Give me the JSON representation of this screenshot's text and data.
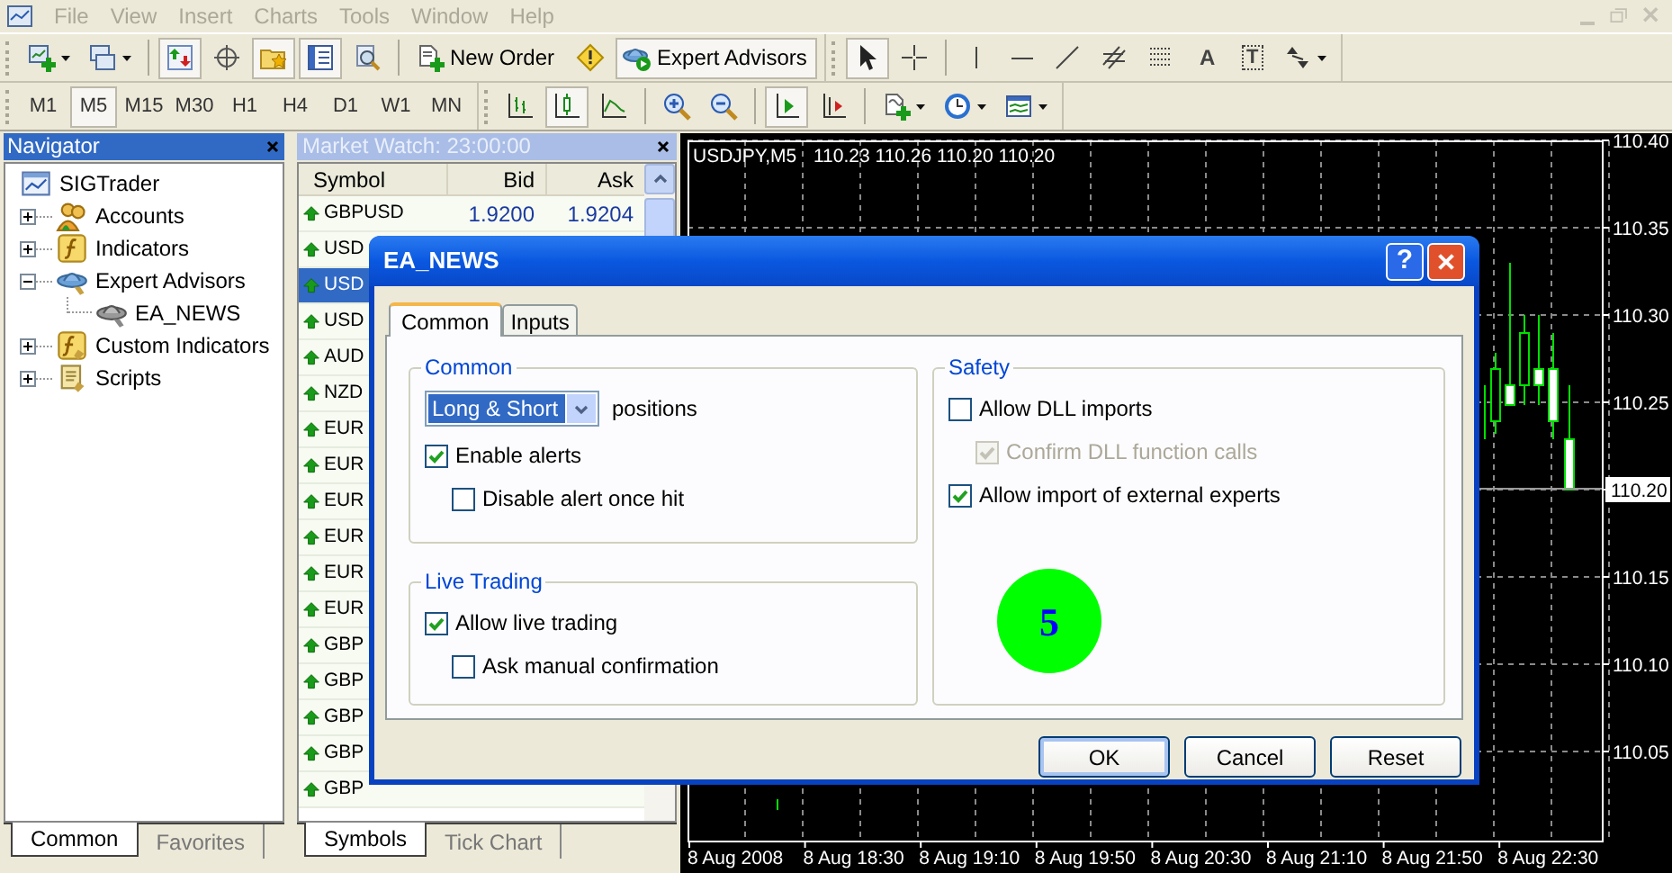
{
  "menu": [
    "File",
    "View",
    "Insert",
    "Charts",
    "Tools",
    "Window",
    "Help"
  ],
  "toolbars": [
    {
      "segments": [
        {
          "items": [
            {
              "kind": "new-chart",
              "on": false,
              "dropdown": true
            },
            {
              "kind": "profiles",
              "on": false,
              "dropdown": true
            },
            {
              "kind": "separator"
            },
            {
              "kind": "market-watch",
              "on": true
            },
            {
              "kind": "data-window",
              "on": false
            },
            {
              "kind": "navigator",
              "on": true
            },
            {
              "kind": "terminal",
              "on": true
            },
            {
              "kind": "tester",
              "on": false
            },
            {
              "kind": "separator"
            },
            {
              "kind": "new-order",
              "label": "New Order",
              "on": false
            },
            {
              "kind": "metaeditor",
              "on": false
            },
            {
              "kind": "expert-advisors",
              "label": "Expert Advisors",
              "on": true
            }
          ]
        },
        {
          "items": [
            {
              "kind": "cursor",
              "on": true
            },
            {
              "kind": "crosshair",
              "on": false
            },
            {
              "kind": "separator"
            },
            {
              "kind": "vline",
              "on": false
            },
            {
              "kind": "hline",
              "on": false
            },
            {
              "kind": "trendline",
              "on": false
            },
            {
              "kind": "fibo-e",
              "on": false
            },
            {
              "kind": "fibo-f",
              "on": false
            },
            {
              "kind": "text",
              "label": "A",
              "on": false
            },
            {
              "kind": "label",
              "label": "T",
              "on": false
            },
            {
              "kind": "arrows",
              "on": false,
              "dropdown": true
            }
          ]
        }
      ]
    },
    {
      "segments": [
        {
          "items": [
            {
              "kind": "period",
              "label": "M1",
              "on": false
            },
            {
              "kind": "period",
              "label": "M5",
              "on": true
            },
            {
              "kind": "period",
              "label": "M15",
              "on": false
            },
            {
              "kind": "period",
              "label": "M30",
              "on": false
            },
            {
              "kind": "period",
              "label": "H1",
              "on": false
            },
            {
              "kind": "period",
              "label": "H4",
              "on": false
            },
            {
              "kind": "period",
              "label": "D1",
              "on": false
            },
            {
              "kind": "period",
              "label": "W1",
              "on": false
            },
            {
              "kind": "period",
              "label": "MN",
              "on": false
            }
          ]
        },
        {
          "items": [
            {
              "kind": "bar-chart",
              "on": false
            },
            {
              "kind": "candles",
              "on": true
            },
            {
              "kind": "line-chart",
              "on": false
            },
            {
              "kind": "separator"
            },
            {
              "kind": "zoom-in",
              "on": false
            },
            {
              "kind": "zoom-out",
              "on": false
            },
            {
              "kind": "separator"
            },
            {
              "kind": "autoscroll",
              "on": true
            },
            {
              "kind": "chart-shift",
              "on": false
            },
            {
              "kind": "separator"
            },
            {
              "kind": "indicators",
              "on": false,
              "dropdown": true
            },
            {
              "kind": "periods",
              "on": false,
              "dropdown": true
            },
            {
              "kind": "templates",
              "on": false,
              "dropdown": true
            }
          ]
        }
      ]
    }
  ],
  "navigator": {
    "title": "Navigator",
    "tree": {
      "label": "SIGTrader",
      "kind": "terminal",
      "children": [
        {
          "label": "Accounts",
          "kind": "accounts",
          "expanded": false
        },
        {
          "label": "Indicators",
          "kind": "indicators",
          "expanded": false
        },
        {
          "label": "Expert Advisors",
          "kind": "experts",
          "expanded": true,
          "children": [
            {
              "label": "EA_NEWS",
              "kind": "expert"
            }
          ]
        },
        {
          "label": "Custom Indicators",
          "kind": "custom",
          "expanded": false
        },
        {
          "label": "Scripts",
          "kind": "scripts",
          "expanded": false
        }
      ]
    },
    "tabs": [
      {
        "label": "Common",
        "selected": true
      },
      {
        "label": "Favorites",
        "selected": false
      }
    ]
  },
  "market_watch": {
    "title": "Market Watch: 23:00:00",
    "columns": [
      "Symbol",
      "Bid",
      "Ask"
    ],
    "rows": [
      {
        "symbol": "GBPUSD",
        "bid": "1.9200",
        "ask": "1.9204",
        "selected": false
      },
      {
        "symbol": "USD",
        "selected": false
      },
      {
        "symbol": "USD",
        "selected": true
      },
      {
        "symbol": "USD",
        "selected": false
      },
      {
        "symbol": "AUD",
        "selected": false
      },
      {
        "symbol": "NZD",
        "selected": false
      },
      {
        "symbol": "EUR",
        "selected": false
      },
      {
        "symbol": "EUR",
        "selected": false
      },
      {
        "symbol": "EUR",
        "selected": false
      },
      {
        "symbol": "EUR",
        "selected": false
      },
      {
        "symbol": "EUR",
        "selected": false
      },
      {
        "symbol": "EUR",
        "selected": false
      },
      {
        "symbol": "GBP",
        "selected": false
      },
      {
        "symbol": "GBP",
        "selected": false
      },
      {
        "symbol": "GBP",
        "selected": false
      },
      {
        "symbol": "GBP",
        "selected": false
      },
      {
        "symbol": "GBP",
        "selected": false
      }
    ],
    "tabs": [
      {
        "label": "Symbols",
        "selected": true
      },
      {
        "label": "Tick Chart",
        "selected": false
      }
    ]
  },
  "chart": {
    "symbol": "USDJPY,M5",
    "ohlc": "110.23 110.26 110.20 110.20",
    "price_labels": [
      {
        "label": "110.40",
        "current": false
      },
      {
        "label": "110.35",
        "current": false
      },
      {
        "label": "110.30",
        "current": false
      },
      {
        "label": "110.25",
        "current": false
      },
      {
        "label": "110.20",
        "current": true
      },
      {
        "label": "110.15",
        "current": false
      },
      {
        "label": "110.10",
        "current": false
      },
      {
        "label": "110.05",
        "current": false
      }
    ],
    "time_labels": [
      "8 Aug 2008",
      "8 Aug 18:30",
      "8 Aug 19:10",
      "8 Aug 19:50",
      "8 Aug 20:30",
      "8 Aug 21:10",
      "8 Aug 21:50",
      "8 Aug 22:30"
    ]
  },
  "dialog": {
    "title": "EA_NEWS",
    "help": "?",
    "tabs": [
      {
        "label": "Common",
        "selected": true
      },
      {
        "label": "Inputs",
        "selected": false
      }
    ],
    "groups": [
      {
        "title": "Common",
        "select": {
          "value": "Long & Short",
          "label": "positions"
        },
        "options": [
          {
            "label": "Enable alerts",
            "checked": true,
            "disabled": false,
            "children": [
              {
                "label": "Disable alert once hit",
                "checked": false,
                "disabled": false
              }
            ]
          }
        ]
      },
      {
        "title": "Live Trading",
        "options": [
          {
            "label": "Allow live trading",
            "checked": true,
            "disabled": false,
            "children": [
              {
                "label": "Ask manual confirmation",
                "checked": false,
                "disabled": false
              }
            ]
          }
        ]
      },
      {
        "title": "Safety",
        "options": [
          {
            "label": "Allow DLL imports",
            "checked": false,
            "disabled": false,
            "children": [
              {
                "label": "Confirm DLL function calls",
                "checked": true,
                "disabled": true
              }
            ]
          },
          {
            "label": "Allow import of external experts",
            "checked": true,
            "disabled": false
          }
        ],
        "badge": "5"
      }
    ],
    "buttons": [
      {
        "label": "OK",
        "default": true
      },
      {
        "label": "Cancel",
        "default": false
      },
      {
        "label": "Reset",
        "default": false
      }
    ]
  }
}
